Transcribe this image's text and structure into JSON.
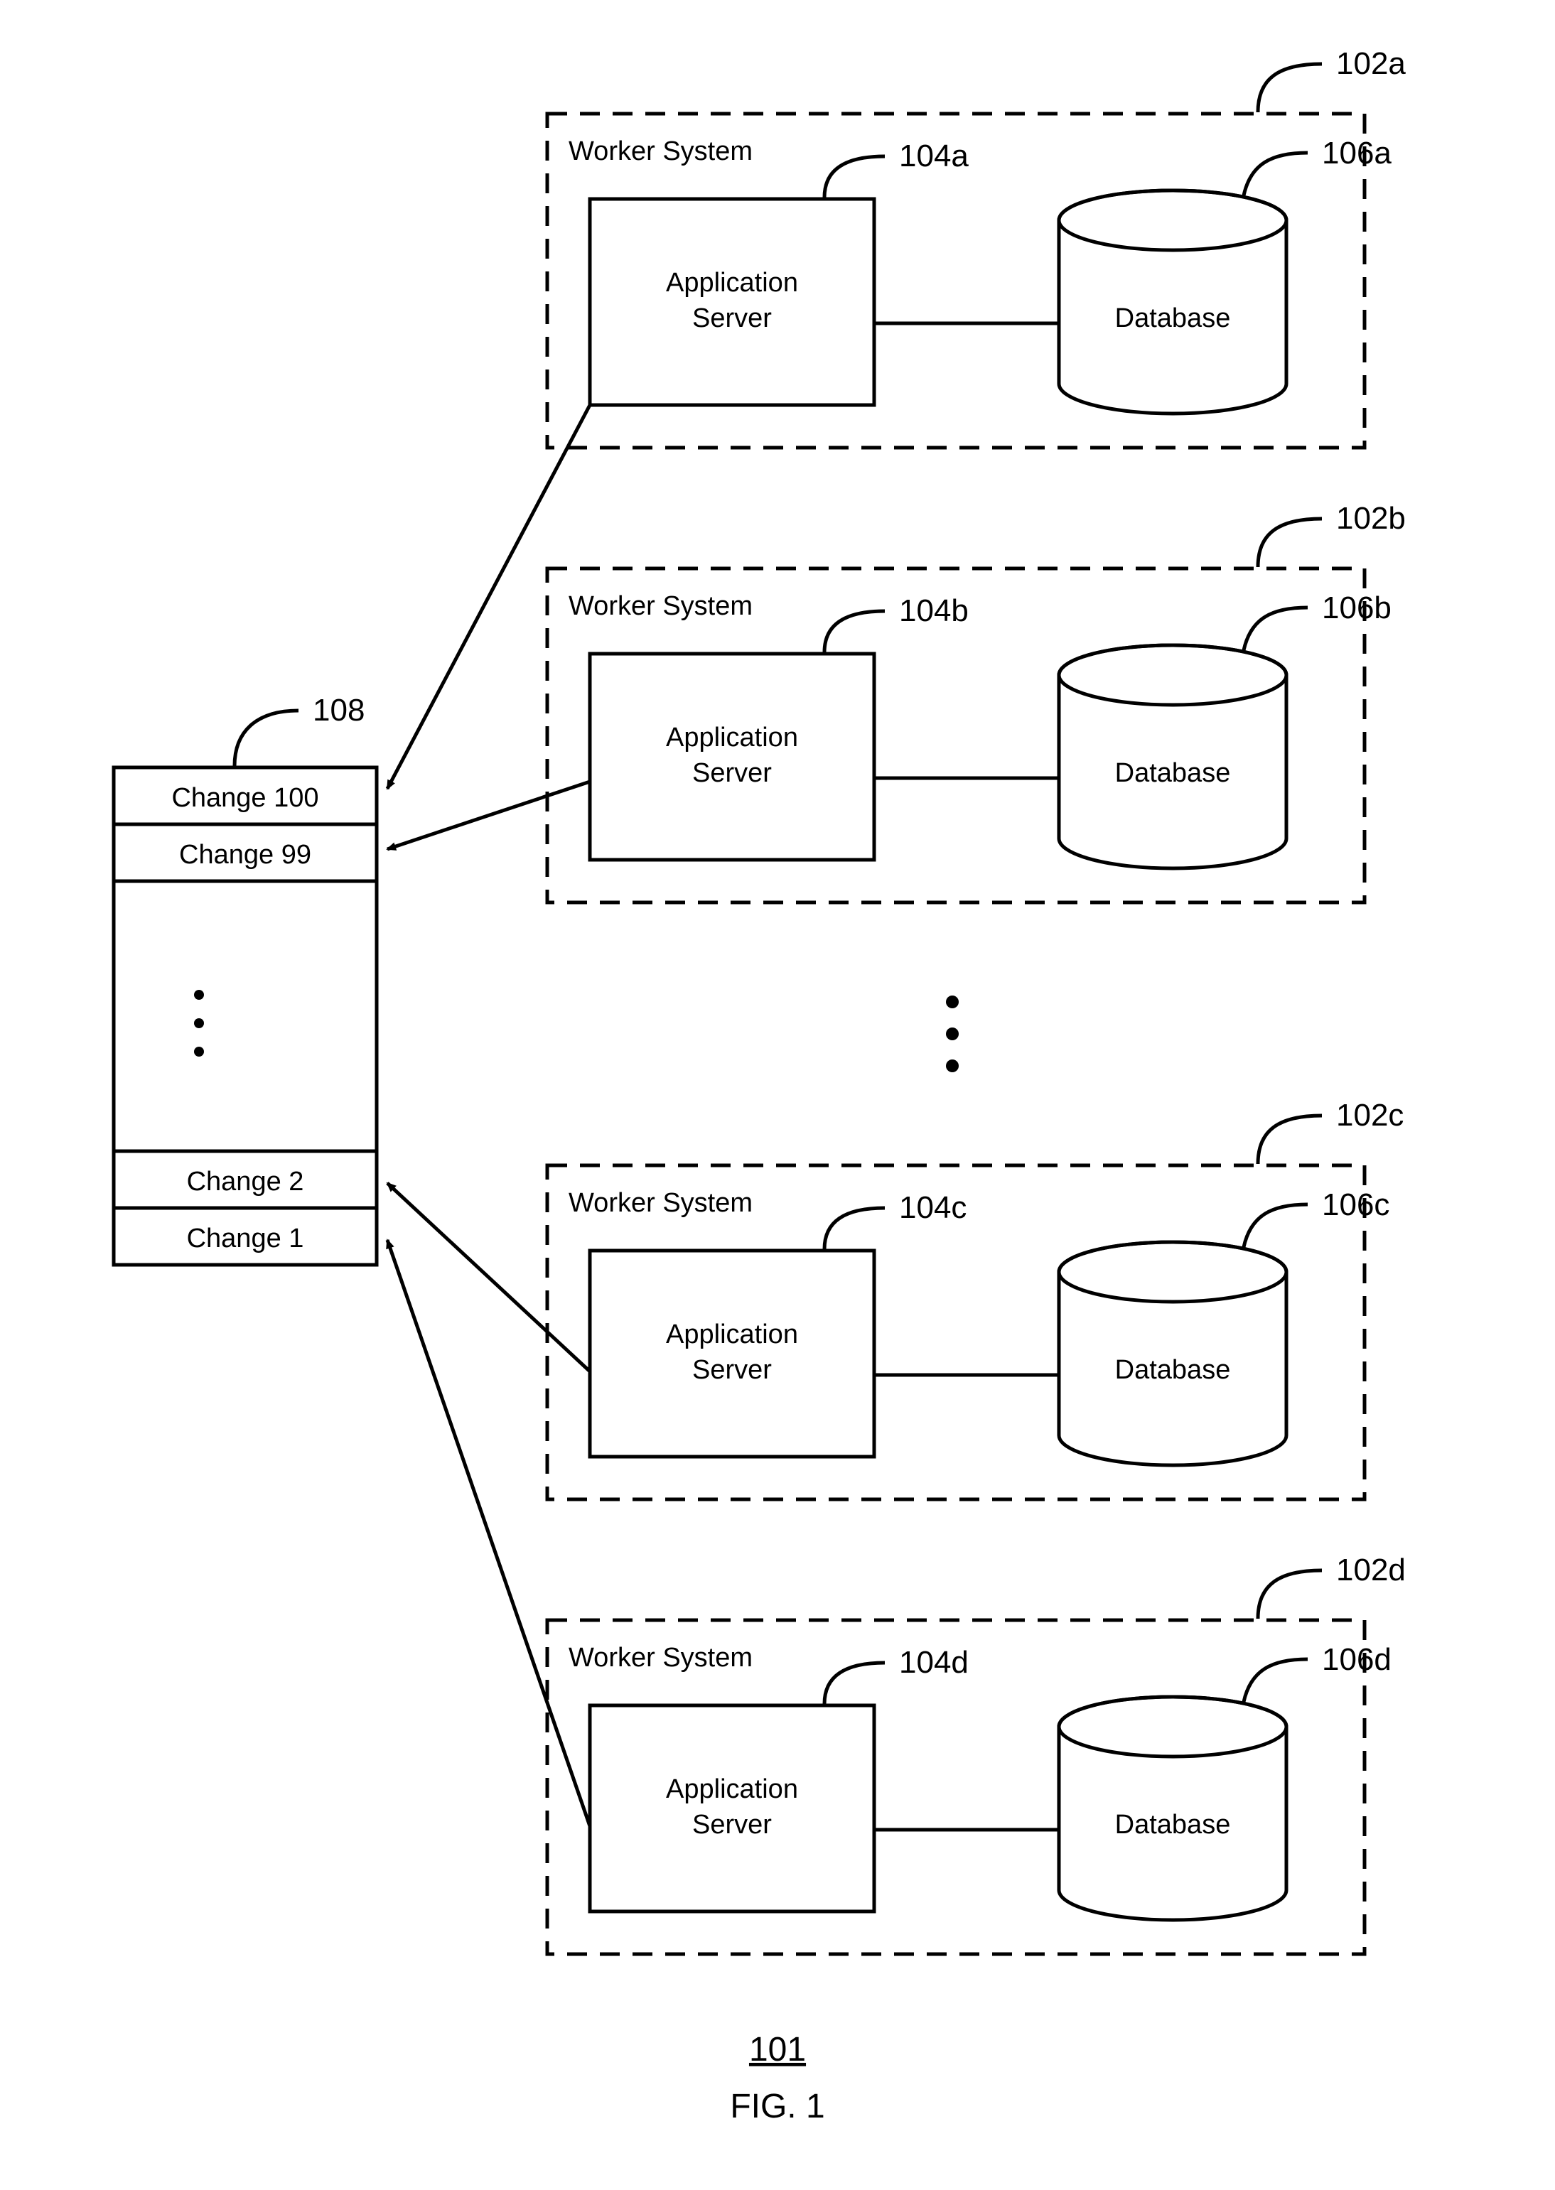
{
  "figure": {
    "number_label": "101",
    "caption": "FIG. 1"
  },
  "change_list": {
    "ref": "108",
    "items_top": [
      "Change 100",
      "Change 99"
    ],
    "items_bottom": [
      "Change 2",
      "Change 1"
    ]
  },
  "worker_systems": [
    {
      "ref": "102a",
      "title": "Worker System",
      "app_server": {
        "ref": "104a",
        "label_line1": "Application",
        "label_line2": "Server"
      },
      "database": {
        "ref": "106a",
        "label": "Database"
      }
    },
    {
      "ref": "102b",
      "title": "Worker System",
      "app_server": {
        "ref": "104b",
        "label_line1": "Application",
        "label_line2": "Server"
      },
      "database": {
        "ref": "106b",
        "label": "Database"
      }
    },
    {
      "ref": "102c",
      "title": "Worker System",
      "app_server": {
        "ref": "104c",
        "label_line1": "Application",
        "label_line2": "Server"
      },
      "database": {
        "ref": "106c",
        "label": "Database"
      }
    },
    {
      "ref": "102d",
      "title": "Worker System",
      "app_server": {
        "ref": "104d",
        "label_line1": "Application",
        "label_line2": "Server"
      },
      "database": {
        "ref": "106d",
        "label": "Database"
      }
    }
  ]
}
